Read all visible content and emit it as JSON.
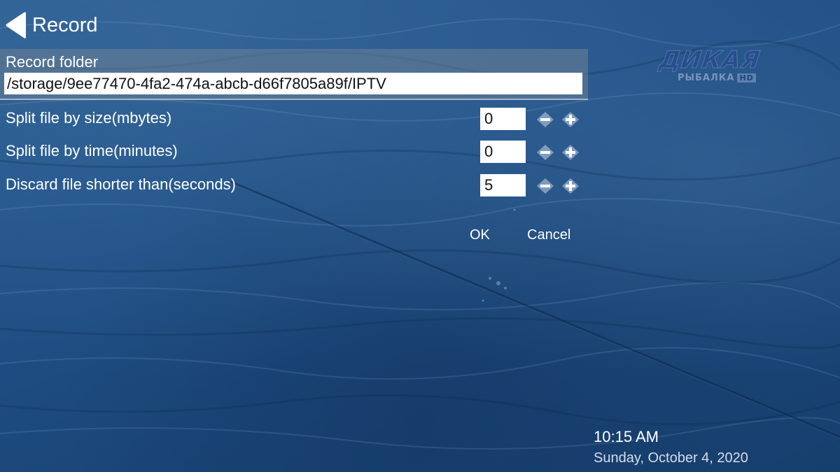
{
  "header": {
    "title": "Record",
    "back_icon": "back-arrow-icon"
  },
  "logo": {
    "main": "ДИКАЯ",
    "sub": "РЫБАЛКА",
    "hd": "HD"
  },
  "record_folder": {
    "label": "Record folder",
    "value": "/storage/9ee77470-4fa2-474a-abcb-d66f7805a89f/IPTV"
  },
  "settings": [
    {
      "label": "Split file by size(mbytes)",
      "value": "0"
    },
    {
      "label": "Split file by time(minutes)",
      "value": "0"
    },
    {
      "label": "Discard file shorter than(seconds)",
      "value": "5"
    }
  ],
  "actions": {
    "ok": "OK",
    "cancel": "Cancel"
  },
  "status": {
    "time": "10:15 AM",
    "date": "Sunday, October 4, 2020"
  },
  "colors": {
    "background": "#1f4f85",
    "folder_panel": "#6e8296",
    "text": "#ffffff",
    "input_bg": "#ffffff"
  }
}
